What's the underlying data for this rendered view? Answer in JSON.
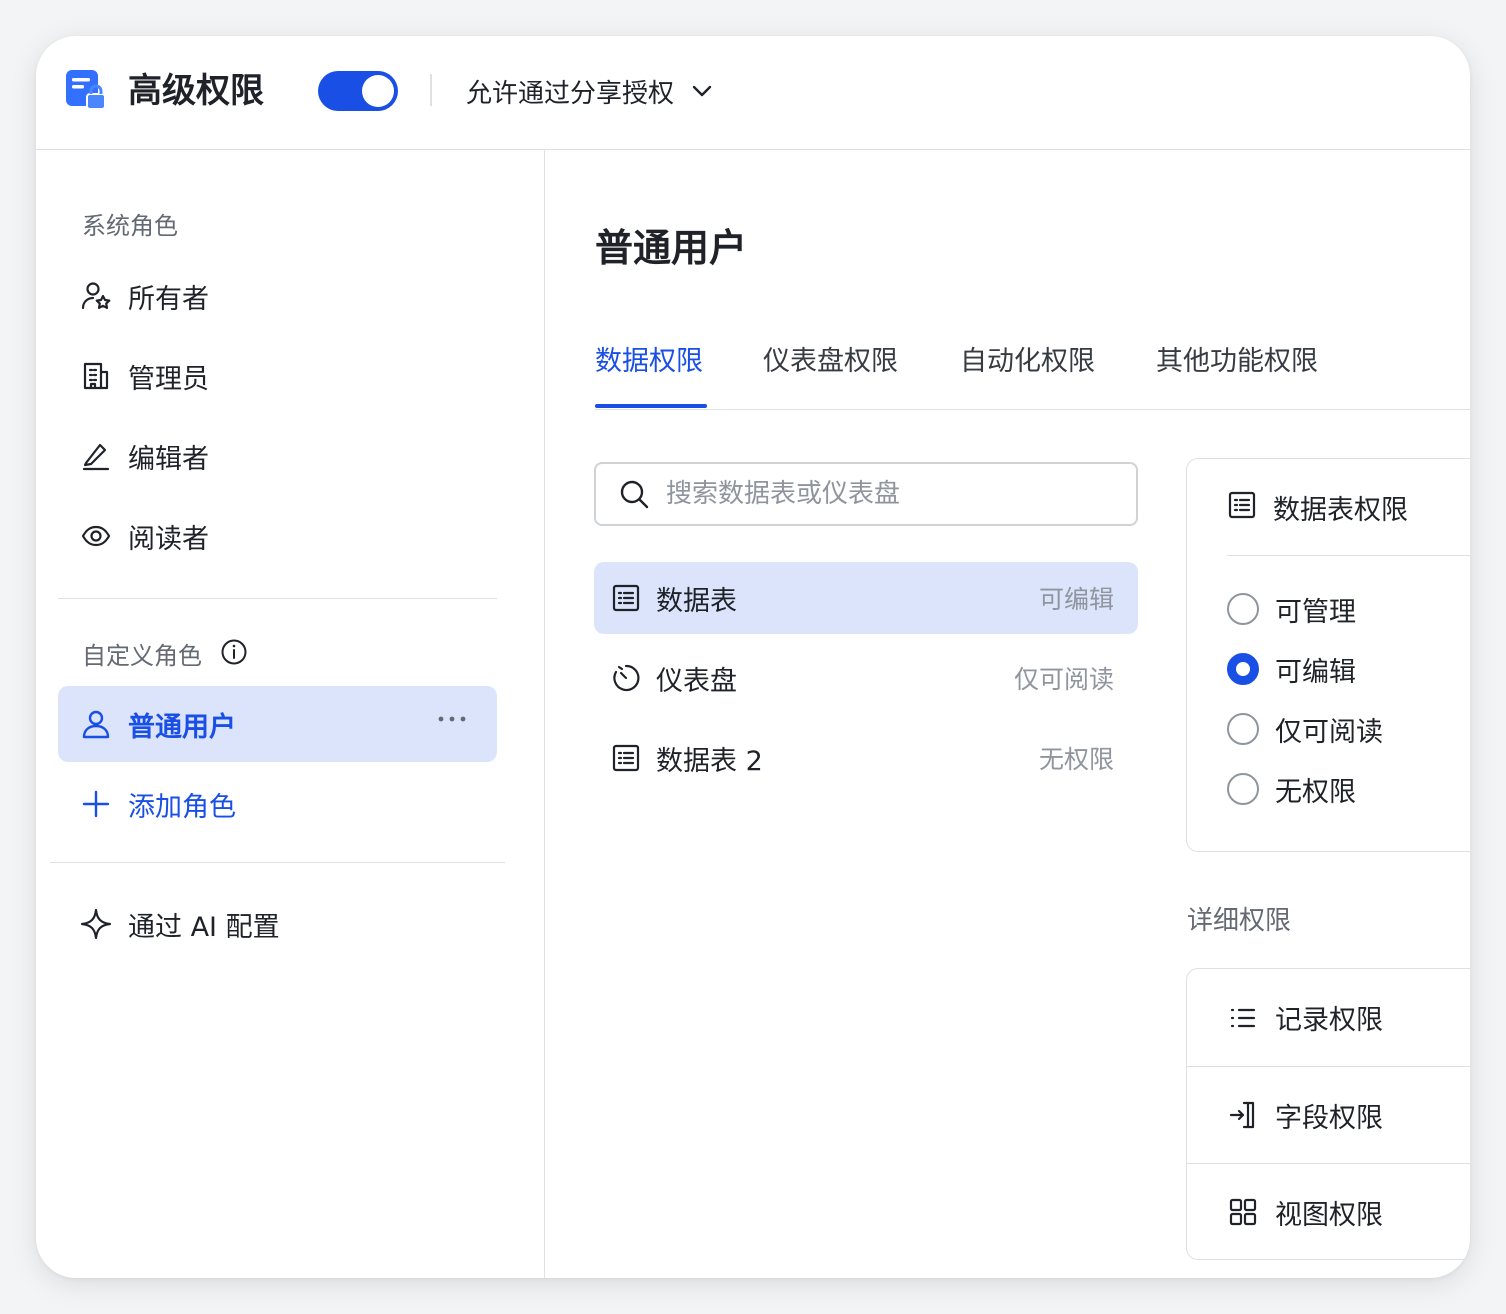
{
  "header": {
    "title": "高级权限",
    "toggle_on": true,
    "share_option": "允许通过分享授权",
    "app_icon": "form-lock-icon",
    "accent_color": "#1a4fe6"
  },
  "sidebar": {
    "system_roles_label": "系统角色",
    "system_roles": [
      {
        "label": "所有者",
        "icon": "user-star-icon"
      },
      {
        "label": "管理员",
        "icon": "building-icon"
      },
      {
        "label": "编辑者",
        "icon": "pencil-icon"
      },
      {
        "label": "阅读者",
        "icon": "eye-icon"
      }
    ],
    "custom_roles_label": "自定义角色",
    "custom_roles": [
      {
        "label": "普通用户",
        "icon": "user-icon",
        "active": true
      }
    ],
    "add_role_label": "添加角色",
    "ai_config_label": "通过 AI 配置"
  },
  "main": {
    "title": "普通用户",
    "tabs": [
      {
        "label": "数据权限",
        "active": true
      },
      {
        "label": "仪表盘权限"
      },
      {
        "label": "自动化权限"
      },
      {
        "label": "其他功能权限"
      }
    ],
    "search": {
      "placeholder": "搜索数据表或仪表盘",
      "value": ""
    },
    "resources": [
      {
        "label": "数据表",
        "permission": "可编辑",
        "icon": "table-icon",
        "active": true
      },
      {
        "label": "仪表盘",
        "permission": "仅可阅读",
        "icon": "dashboard-icon"
      },
      {
        "label": "数据表 2",
        "permission": "无权限",
        "icon": "table-icon"
      }
    ]
  },
  "permission_panel": {
    "title": "数据表权限",
    "options": [
      {
        "label": "可管理",
        "checked": false
      },
      {
        "label": "可编辑",
        "checked": true
      },
      {
        "label": "仅可阅读",
        "checked": false
      },
      {
        "label": "无权限",
        "checked": false
      }
    ],
    "detail_label": "详细权限",
    "details": [
      {
        "label": "记录权限",
        "icon": "list-icon"
      },
      {
        "label": "字段权限",
        "icon": "field-icon"
      },
      {
        "label": "视图权限",
        "icon": "grid-icon"
      }
    ]
  }
}
